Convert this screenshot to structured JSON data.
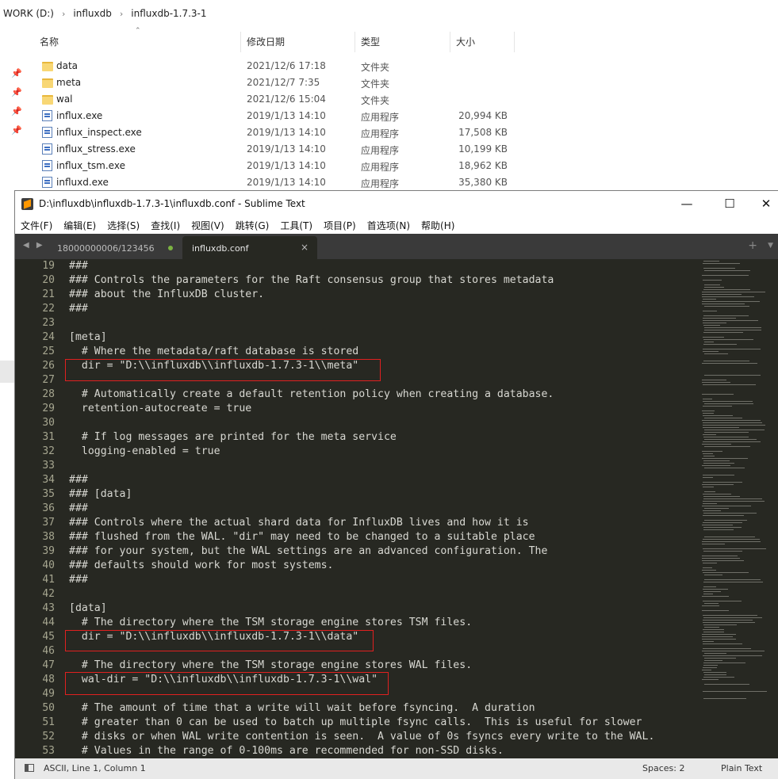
{
  "explorer": {
    "breadcrumb": [
      "WORK (D:)",
      "influxdb",
      "influxdb-1.7.3-1"
    ],
    "columns": {
      "name": "名称",
      "date": "修改日期",
      "type": "类型",
      "size": "大小"
    },
    "files": [
      {
        "icon": "folder",
        "name": "data",
        "date": "2021/12/6 17:18",
        "type": "文件夹",
        "size": ""
      },
      {
        "icon": "folder",
        "name": "meta",
        "date": "2021/12/7 7:35",
        "type": "文件夹",
        "size": ""
      },
      {
        "icon": "folder",
        "name": "wal",
        "date": "2021/12/6 15:04",
        "type": "文件夹",
        "size": ""
      },
      {
        "icon": "exe",
        "name": "influx.exe",
        "date": "2019/1/13 14:10",
        "type": "应用程序",
        "size": "20,994 KB"
      },
      {
        "icon": "exe",
        "name": "influx_inspect.exe",
        "date": "2019/1/13 14:10",
        "type": "应用程序",
        "size": "17,508 KB"
      },
      {
        "icon": "exe",
        "name": "influx_stress.exe",
        "date": "2019/1/13 14:10",
        "type": "应用程序",
        "size": "10,199 KB"
      },
      {
        "icon": "exe",
        "name": "influx_tsm.exe",
        "date": "2019/1/13 14:10",
        "type": "应用程序",
        "size": "18,962 KB"
      },
      {
        "icon": "exe",
        "name": "influxd.exe",
        "date": "2019/1/13 14:10",
        "type": "应用程序",
        "size": "35,380 KB"
      }
    ]
  },
  "sublime": {
    "title": "D:\\influxdb\\influxdb-1.7.3-1\\influxdb.conf - Sublime Text",
    "window_buttons": {
      "minimize": "—",
      "maximize": "☐",
      "close": "✕"
    },
    "menu": [
      "文件(F)",
      "编辑(E)",
      "选择(S)",
      "查找(I)",
      "视图(V)",
      "跳转(G)",
      "工具(T)",
      "项目(P)",
      "首选项(N)",
      "帮助(H)"
    ],
    "tabs": [
      {
        "label": "18000000006/123456"
      },
      {
        "label": "influxdb.conf",
        "close": "×"
      }
    ],
    "tab_arrows": "◀ ▶",
    "tab_plus": "+",
    "tab_menu": "▼",
    "first_line": 19,
    "lines": [
      "###",
      "### Controls the parameters for the Raft consensus group that stores metadata",
      "### about the InfluxDB cluster.",
      "###",
      "",
      "[meta]",
      "  # Where the metadata/raft database is stored",
      "  dir = \"D:\\\\influxdb\\\\influxdb-1.7.3-1\\\\meta\"",
      "",
      "  # Automatically create a default retention policy when creating a database.",
      "  retention-autocreate = true",
      "",
      "  # If log messages are printed for the meta service",
      "  logging-enabled = true",
      "",
      "###",
      "### [data]",
      "###",
      "### Controls where the actual shard data for InfluxDB lives and how it is",
      "### flushed from the WAL. \"dir\" may need to be changed to a suitable place",
      "### for your system, but the WAL settings are an advanced configuration. The",
      "### defaults should work for most systems.",
      "###",
      "",
      "[data]",
      "  # The directory where the TSM storage engine stores TSM files.",
      "  dir = \"D:\\\\influxdb\\\\influxdb-1.7.3-1\\\\data\"",
      "",
      "  # The directory where the TSM storage engine stores WAL files.",
      "  wal-dir = \"D:\\\\influxdb\\\\influxdb-1.7.3-1\\\\wal\"",
      "",
      "  # The amount of time that a write will wait before fsyncing.  A duration",
      "  # greater than 0 can be used to batch up multiple fsync calls.  This is useful for slower",
      "  # disks or when WAL write contention is seen.  A value of 0s fsyncs every write to the WAL.",
      "  # Values in the range of 0-100ms are recommended for non-SSD disks."
    ],
    "highlight_lines": [
      26,
      45,
      48
    ],
    "status": {
      "position": "ASCII, Line 1, Column 1",
      "spaces": "Spaces: 2",
      "syntax": "Plain Text"
    }
  }
}
